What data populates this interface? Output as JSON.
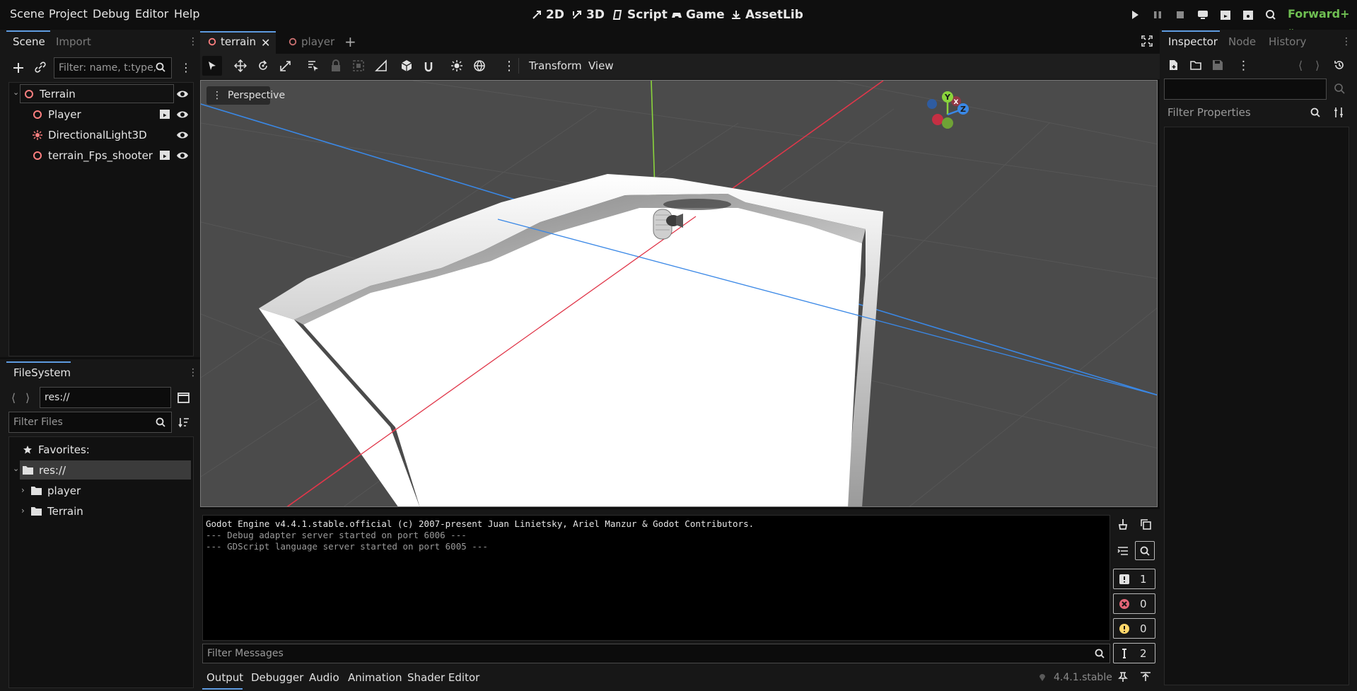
{
  "menu": [
    "Scene",
    "Project",
    "Debug",
    "Editor",
    "Help"
  ],
  "workspaces": [
    {
      "label": "2D",
      "icon": "2d-icon"
    },
    {
      "label": "3D",
      "icon": "3d-icon"
    },
    {
      "label": "Script",
      "icon": "script-icon"
    },
    {
      "label": "Game",
      "icon": "game-icon"
    },
    {
      "label": "AssetLib",
      "icon": "assetlib-icon"
    }
  ],
  "renderer": "Forward+",
  "scene_dock": {
    "tabs": [
      "Scene",
      "Import"
    ],
    "filter_placeholder": "Filter: name, t:type,",
    "tree": [
      {
        "name": "Terrain",
        "icon": "node3d-icon",
        "level": 0
      },
      {
        "name": "Player",
        "icon": "node3d-icon",
        "level": 1,
        "instanced": true
      },
      {
        "name": "DirectionalLight3D",
        "icon": "light-icon",
        "level": 1
      },
      {
        "name": "terrain_Fps_shooter",
        "icon": "node3d-icon",
        "level": 1,
        "instanced": true
      }
    ]
  },
  "filesystem": {
    "tab": "FileSystem",
    "path": "res://",
    "filter_placeholder": "Filter Files",
    "items": [
      {
        "label": "Favorites:",
        "icon": "star-icon"
      },
      {
        "label": "res://",
        "icon": "folder-icon"
      },
      {
        "label": "player",
        "icon": "folder-icon"
      },
      {
        "label": "Terrain",
        "icon": "folder-icon"
      }
    ]
  },
  "scene_tabs": [
    "terrain",
    "player"
  ],
  "toolbar_menus": [
    "Transform",
    "View"
  ],
  "viewport": {
    "label": "Perspective",
    "gizmo_axes": [
      "Y",
      "X",
      "Z"
    ]
  },
  "output": {
    "lines": [
      "Godot Engine v4.4.1.stable.official (c) 2007-present Juan Linietsky, Ariel Manzur & Godot Contributors.",
      "--- Debug adapter server started on port 6006 ---",
      "--- GDScript language server started on port 6005 ---"
    ],
    "filter_placeholder": "Filter Messages",
    "counters": {
      "messages": "1",
      "errors": "0",
      "warnings": "0",
      "editor": "2"
    }
  },
  "bottom_tabs": [
    "Output",
    "Debugger",
    "Audio",
    "Animation",
    "Shader Editor"
  ],
  "version": "4.4.1.stable",
  "inspector": {
    "tabs": [
      "Inspector",
      "Node",
      "History"
    ],
    "filter_placeholder": "Filter Properties"
  },
  "colors": {
    "accent": "#5e9be0",
    "node3d": "#fc7f7f",
    "renderer": "#6fbf52",
    "axis_x": "#e0374a",
    "axis_y": "#8ad43c",
    "axis_z": "#3a88e6"
  }
}
